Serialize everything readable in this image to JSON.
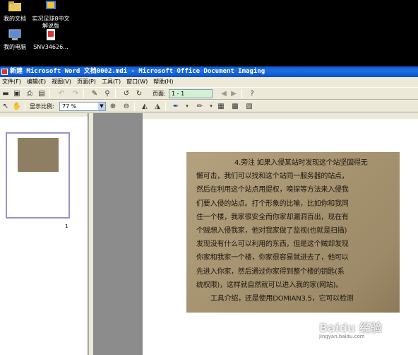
{
  "desktop": {
    "icons": [
      {
        "label": "我的文档"
      },
      {
        "label": "实况足球8中文解说版"
      },
      {
        "label": "我的电脑"
      },
      {
        "label": "SNV34626..."
      }
    ]
  },
  "window": {
    "title": "新建 Microsoft Word 文档0002.mdi - Microsoft Office Document Imaging"
  },
  "menu": [
    "文件(F)",
    "编辑(E)",
    "视图(V)",
    "页面(P)",
    "工具(T)",
    "窗口(W)",
    "帮助(H)"
  ],
  "toolbar": {
    "page_label": "页面:",
    "page_value": "1 - 1",
    "zoom_label": "显示比例:",
    "zoom_value": "77 %"
  },
  "thumbnail": {
    "page_number": "1"
  },
  "document_lines": [
    "4.旁注 如果入侵某站时发现这个站坚固得无",
    "懈可击，我们可以找和这个站同一服务器的站点，",
    "然后在利用这个站点用提权，嗅探等方法来入侵我",
    "们要入侵的站点。打个形象的比喻，比如你和我同",
    "住一个楼，我家很安全而你家却漏洞百出，现在有",
    "个贼想入侵我家，他对我家做了监视(也就是扫描)",
    "发现没有什么可以利用的东西，但是这个贼却发现",
    "你家和我家一个楼，你家很容易就进去了，他可以",
    "先进入你家，然后通过你家得到整个楼的钥匙(系",
    "统权限)，这样就自然就可以进入我的家(网站)。",
    "工具介绍，还是使用DOMIAN3.5，它可以检测"
  ],
  "watermark": {
    "brand": "Baidu 经验",
    "sub": "jingyan.baidu.com"
  }
}
